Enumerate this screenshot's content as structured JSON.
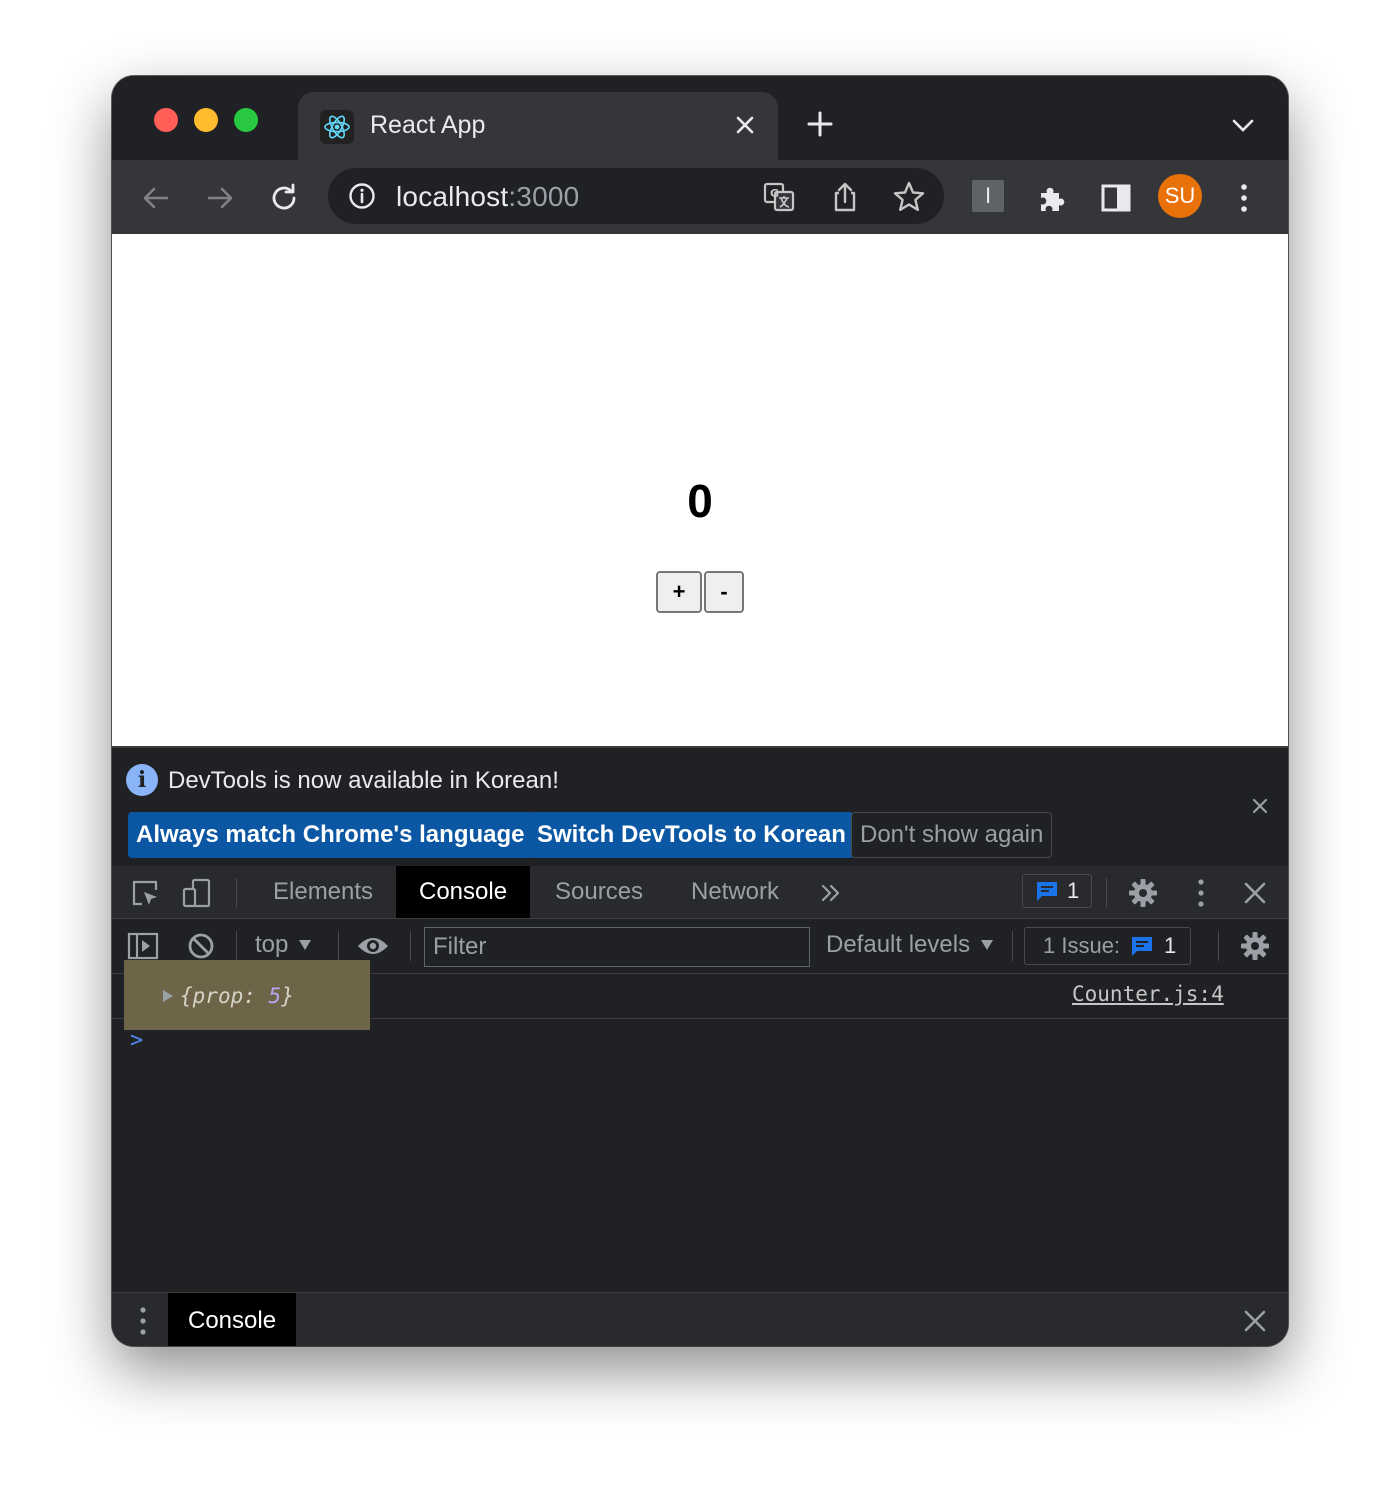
{
  "browser": {
    "tab_title": "React App",
    "url_host": "localhost",
    "url_port": ":3000",
    "profile_initials": "SU",
    "extension_letter": "I"
  },
  "page": {
    "count": "0",
    "increment_label": "+",
    "decrement_label": "-"
  },
  "devtools": {
    "infobar": {
      "message": "DevTools is now available in Korean!",
      "button_match": "Always match Chrome's language",
      "button_switch": "Switch DevTools to Korean",
      "button_dismiss": "Don't show again"
    },
    "tabs": [
      "Elements",
      "Console",
      "Sources",
      "Network"
    ],
    "active_tab": "Console",
    "issues_badge_count": "1",
    "console": {
      "context": "top",
      "filter_placeholder": "Filter",
      "levels_label": "Default levels",
      "issues_label": "1 Issue:",
      "issues_count": "1",
      "log": {
        "open_brace": "{",
        "key": "prop:",
        "value": "5",
        "close_brace": "}",
        "source": "Counter.js:4"
      },
      "prompt_symbol": ">"
    },
    "drawer_tab": "Console"
  },
  "colors": {
    "accent_blue": "#0b57a3",
    "profile_orange": "#e8710a",
    "log_highlight": "#6e6549"
  }
}
